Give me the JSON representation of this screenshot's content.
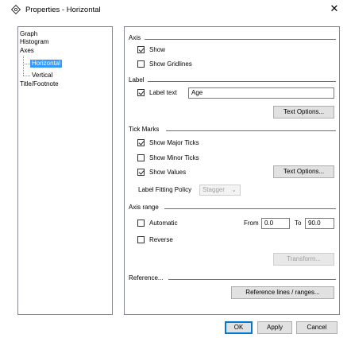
{
  "window": {
    "title": "Properties - Horizontal",
    "close_glyph": "✕",
    "app_icon": "settings-diamond-icon"
  },
  "tree": {
    "items": [
      {
        "label": "Graph"
      },
      {
        "label": "Histogram"
      },
      {
        "label": "Axes"
      },
      {
        "label": "Horizontal",
        "selected": true
      },
      {
        "label": "Vertical"
      },
      {
        "label": "Title/Footnote"
      }
    ]
  },
  "axis": {
    "section": "Axis",
    "show": {
      "label": "Show",
      "checked": true
    },
    "show_gridlines": {
      "label": "Show Gridlines",
      "checked": false
    }
  },
  "label": {
    "section": "Label",
    "label_text": {
      "label": "Label text",
      "checked": true,
      "value": "Age"
    },
    "text_options": "Text Options..."
  },
  "tick_marks": {
    "section": "Tick Marks",
    "show_major": {
      "label": "Show Major Ticks",
      "checked": true
    },
    "show_minor": {
      "label": "Show Minor Ticks",
      "checked": false
    },
    "show_values": {
      "label": "Show Values",
      "checked": true
    },
    "text_options": "Text Options...",
    "fitting_policy_label": "Label Fitting Policy",
    "fitting_policy_value": "Stagger"
  },
  "axis_range": {
    "section": "Axis range",
    "automatic": {
      "label": "Automatic",
      "checked": false
    },
    "from_label": "From",
    "from_value": "0.0",
    "to_label": "To",
    "to_value": "90.0",
    "reverse": {
      "label": "Reverse",
      "checked": false
    },
    "transform": "Transform..."
  },
  "reference": {
    "section": "Reference...",
    "button": "Reference lines / ranges..."
  },
  "footer": {
    "ok": "OK",
    "apply": "Apply",
    "cancel": "Cancel"
  }
}
